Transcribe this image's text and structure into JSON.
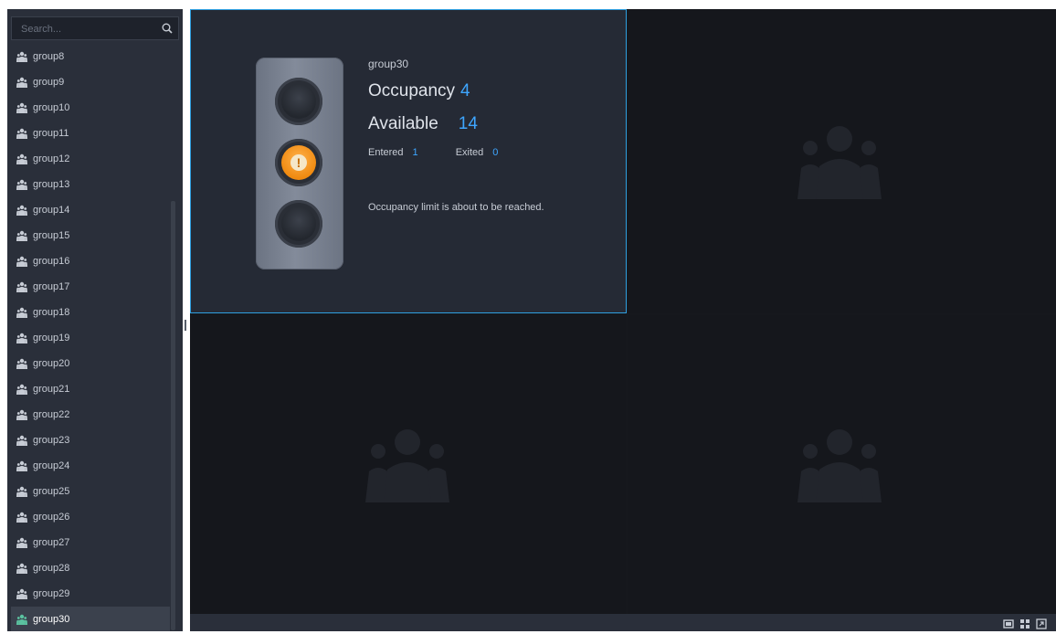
{
  "search": {
    "placeholder": "Search..."
  },
  "groups": [
    {
      "label": "group8"
    },
    {
      "label": "group9"
    },
    {
      "label": "group10"
    },
    {
      "label": "group11"
    },
    {
      "label": "group12"
    },
    {
      "label": "group13"
    },
    {
      "label": "group14"
    },
    {
      "label": "group15"
    },
    {
      "label": "group16"
    },
    {
      "label": "group17"
    },
    {
      "label": "group18"
    },
    {
      "label": "group19"
    },
    {
      "label": "group20"
    },
    {
      "label": "group21"
    },
    {
      "label": "group22"
    },
    {
      "label": "group23"
    },
    {
      "label": "group24"
    },
    {
      "label": "group25"
    },
    {
      "label": "group26"
    },
    {
      "label": "group27"
    },
    {
      "label": "group28"
    },
    {
      "label": "group29"
    },
    {
      "label": "group30",
      "selected": true
    }
  ],
  "occupancy_panel": {
    "group": "group30",
    "occupancy_label": "Occupancy",
    "occupancy_value": "4",
    "available_label": "Available",
    "available_value": "14",
    "entered_label": "Entered",
    "entered_value": "1",
    "exited_label": "Exited",
    "exited_value": "0",
    "status_message": "Occupancy limit is about to be reached.",
    "light_state": "amber"
  },
  "icons": {
    "search": "search-icon",
    "group": "group-people-icon",
    "empty_pane": "people-placeholder-icon",
    "warning": "exclamation-icon",
    "layout_single": "single-layout-icon",
    "layout_quad": "quad-layout-icon",
    "fullscreen": "fullscreen-icon"
  },
  "colors": {
    "accent": "#3ea6ff",
    "selected_border": "#2e9fe0",
    "warning": "#f08a10"
  }
}
